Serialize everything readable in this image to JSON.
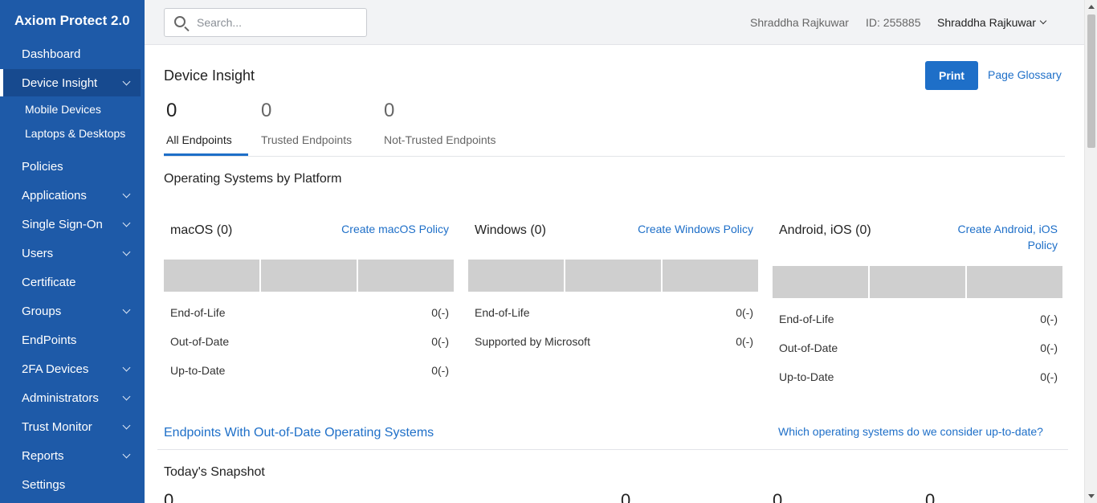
{
  "sidebar": {
    "brand": "Axiom Protect 2.0",
    "items": [
      {
        "label": "Dashboard"
      },
      {
        "label": "Device Insight"
      },
      {
        "label": "Policies"
      },
      {
        "label": "Applications"
      },
      {
        "label": "Single Sign-On"
      },
      {
        "label": "Users"
      },
      {
        "label": "Certificate"
      },
      {
        "label": "Groups"
      },
      {
        "label": "EndPoints"
      },
      {
        "label": "2FA Devices"
      },
      {
        "label": "Administrators"
      },
      {
        "label": "Trust Monitor"
      },
      {
        "label": "Reports"
      },
      {
        "label": "Settings"
      }
    ],
    "subitems": [
      {
        "label": "Mobile Devices"
      },
      {
        "label": "Laptops & Desktops"
      }
    ]
  },
  "topbar": {
    "search_placeholder": "Search...",
    "user_name": "Shraddha Rajkuwar",
    "user_id": "ID: 255885",
    "account_menu": "Shraddha Rajkuwar"
  },
  "main": {
    "title": "Device Insight",
    "print_label": "Print",
    "glossary_label": "Page Glossary",
    "tabs": [
      {
        "count": "0",
        "label": "All Endpoints"
      },
      {
        "count": "0",
        "label": "Trusted Endpoints"
      },
      {
        "count": "0",
        "label": "Not-Trusted Endpoints"
      }
    ],
    "os_section_title": "Operating Systems by Platform",
    "platforms": [
      {
        "title": "macOS (0)",
        "link": "Create macOS Policy",
        "rows": [
          {
            "label": "End-of-Life",
            "value": "0(-)"
          },
          {
            "label": "Out-of-Date",
            "value": "0(-)"
          },
          {
            "label": "Up-to-Date",
            "value": "0(-)"
          }
        ]
      },
      {
        "title": "Windows (0)",
        "link": "Create Windows Policy",
        "rows": [
          {
            "label": "End-of-Life",
            "value": "0(-)"
          },
          {
            "label": "Supported by Microsoft",
            "value": "0(-)"
          }
        ]
      },
      {
        "title": "Android, iOS (0)",
        "link": "Create Android, iOS Policy",
        "rows": [
          {
            "label": "End-of-Life",
            "value": "0(-)"
          },
          {
            "label": "Out-of-Date",
            "value": "0(-)"
          },
          {
            "label": "Up-to-Date",
            "value": "0(-)"
          }
        ]
      }
    ],
    "out_of_date_title": "Endpoints With Out-of-Date Operating Systems",
    "uptodate_question": "Which operating systems do we consider up-to-date?",
    "snapshot_title": "Today's Snapshot",
    "snapshot_values": [
      "0",
      "0",
      "0",
      "0"
    ]
  },
  "colors": {
    "sidebar_bg": "#1e5aa8",
    "accent": "#1e6fc8",
    "bar_gray": "#cfcfcf"
  }
}
